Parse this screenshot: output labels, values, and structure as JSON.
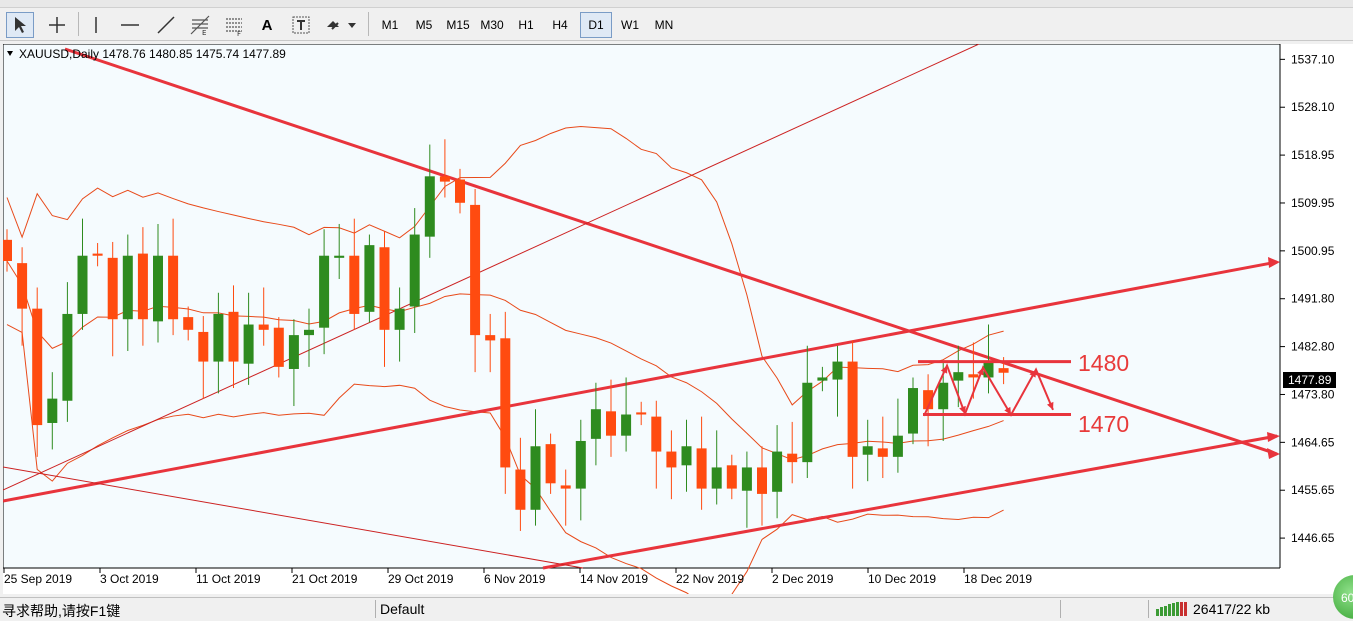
{
  "toolbar": {
    "timeframes": [
      "M1",
      "M5",
      "M15",
      "M30",
      "H1",
      "H4",
      "D1",
      "W1",
      "MN"
    ],
    "active_timeframe": "D1",
    "tools": [
      "cursor-icon",
      "crosshair-icon",
      "vertical-line-icon",
      "horizontal-line-icon",
      "trendline-icon",
      "fibonacci-icon",
      "fibonacci-expansion-icon",
      "text-icon",
      "text-label-icon",
      "arrows-icon"
    ],
    "text_tool_label": "A"
  },
  "chart": {
    "symbol_info": "XAUUSD,Daily  1478.76 1480.85 1475.74 1477.89",
    "current_price": "1477.89",
    "price_labels": [
      "1537.10",
      "1528.10",
      "1518.95",
      "1509.95",
      "1500.95",
      "1491.80",
      "1482.80",
      "1473.80",
      "1464.65",
      "1455.65",
      "1446.65"
    ],
    "date_labels": [
      "25 Sep 2019",
      "3 Oct 2019",
      "11 Oct 2019",
      "21 Oct 2019",
      "29 Oct 2019",
      "6 Nov 2019",
      "14 Nov 2019",
      "22 Nov 2019",
      "2 Dec 2019",
      "10 Dec 2019",
      "18 Dec 2019"
    ],
    "annotations": [
      "1480",
      "1470"
    ],
    "colors": {
      "bull": "#2e8b1f",
      "bear": "#ff4b10",
      "bands": "#e84a1a",
      "trendline": "#e8343c",
      "thin_line": "#cc2222",
      "background": "#f5fbfe"
    }
  },
  "chart_data": {
    "type": "candlestick",
    "title": "XAUUSD,Daily",
    "ylim": [
      1441.0,
      1540.0
    ],
    "x": [
      "25 Sep 2019",
      "3 Oct 2019",
      "11 Oct 2019",
      "21 Oct 2019",
      "29 Oct 2019",
      "6 Nov 2019",
      "14 Nov 2019",
      "22 Nov 2019",
      "2 Dec 2019",
      "10 Dec 2019",
      "18 Dec 2019"
    ],
    "last": {
      "open": 1478.76,
      "high": 1480.85,
      "low": 1475.74,
      "close": 1477.89
    },
    "horizontal_levels": [
      1480,
      1470
    ]
  },
  "status": {
    "help": "寻求帮助,请按F1键",
    "profile": "Default",
    "traffic": "26417/22 kb",
    "ball": "60"
  }
}
